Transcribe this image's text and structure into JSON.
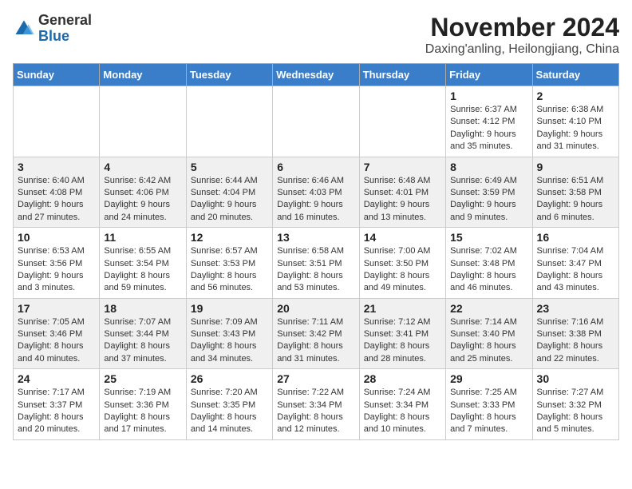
{
  "header": {
    "logo_general": "General",
    "logo_blue": "Blue",
    "month_year": "November 2024",
    "location": "Daxing'anling, Heilongjiang, China"
  },
  "days_of_week": [
    "Sunday",
    "Monday",
    "Tuesday",
    "Wednesday",
    "Thursday",
    "Friday",
    "Saturday"
  ],
  "weeks": [
    [
      {
        "day": "",
        "info": ""
      },
      {
        "day": "",
        "info": ""
      },
      {
        "day": "",
        "info": ""
      },
      {
        "day": "",
        "info": ""
      },
      {
        "day": "",
        "info": ""
      },
      {
        "day": "1",
        "info": "Sunrise: 6:37 AM\nSunset: 4:12 PM\nDaylight: 9 hours\nand 35 minutes."
      },
      {
        "day": "2",
        "info": "Sunrise: 6:38 AM\nSunset: 4:10 PM\nDaylight: 9 hours\nand 31 minutes."
      }
    ],
    [
      {
        "day": "3",
        "info": "Sunrise: 6:40 AM\nSunset: 4:08 PM\nDaylight: 9 hours\nand 27 minutes."
      },
      {
        "day": "4",
        "info": "Sunrise: 6:42 AM\nSunset: 4:06 PM\nDaylight: 9 hours\nand 24 minutes."
      },
      {
        "day": "5",
        "info": "Sunrise: 6:44 AM\nSunset: 4:04 PM\nDaylight: 9 hours\nand 20 minutes."
      },
      {
        "day": "6",
        "info": "Sunrise: 6:46 AM\nSunset: 4:03 PM\nDaylight: 9 hours\nand 16 minutes."
      },
      {
        "day": "7",
        "info": "Sunrise: 6:48 AM\nSunset: 4:01 PM\nDaylight: 9 hours\nand 13 minutes."
      },
      {
        "day": "8",
        "info": "Sunrise: 6:49 AM\nSunset: 3:59 PM\nDaylight: 9 hours\nand 9 minutes."
      },
      {
        "day": "9",
        "info": "Sunrise: 6:51 AM\nSunset: 3:58 PM\nDaylight: 9 hours\nand 6 minutes."
      }
    ],
    [
      {
        "day": "10",
        "info": "Sunrise: 6:53 AM\nSunset: 3:56 PM\nDaylight: 9 hours\nand 3 minutes."
      },
      {
        "day": "11",
        "info": "Sunrise: 6:55 AM\nSunset: 3:54 PM\nDaylight: 8 hours\nand 59 minutes."
      },
      {
        "day": "12",
        "info": "Sunrise: 6:57 AM\nSunset: 3:53 PM\nDaylight: 8 hours\nand 56 minutes."
      },
      {
        "day": "13",
        "info": "Sunrise: 6:58 AM\nSunset: 3:51 PM\nDaylight: 8 hours\nand 53 minutes."
      },
      {
        "day": "14",
        "info": "Sunrise: 7:00 AM\nSunset: 3:50 PM\nDaylight: 8 hours\nand 49 minutes."
      },
      {
        "day": "15",
        "info": "Sunrise: 7:02 AM\nSunset: 3:48 PM\nDaylight: 8 hours\nand 46 minutes."
      },
      {
        "day": "16",
        "info": "Sunrise: 7:04 AM\nSunset: 3:47 PM\nDaylight: 8 hours\nand 43 minutes."
      }
    ],
    [
      {
        "day": "17",
        "info": "Sunrise: 7:05 AM\nSunset: 3:46 PM\nDaylight: 8 hours\nand 40 minutes."
      },
      {
        "day": "18",
        "info": "Sunrise: 7:07 AM\nSunset: 3:44 PM\nDaylight: 8 hours\nand 37 minutes."
      },
      {
        "day": "19",
        "info": "Sunrise: 7:09 AM\nSunset: 3:43 PM\nDaylight: 8 hours\nand 34 minutes."
      },
      {
        "day": "20",
        "info": "Sunrise: 7:11 AM\nSunset: 3:42 PM\nDaylight: 8 hours\nand 31 minutes."
      },
      {
        "day": "21",
        "info": "Sunrise: 7:12 AM\nSunset: 3:41 PM\nDaylight: 8 hours\nand 28 minutes."
      },
      {
        "day": "22",
        "info": "Sunrise: 7:14 AM\nSunset: 3:40 PM\nDaylight: 8 hours\nand 25 minutes."
      },
      {
        "day": "23",
        "info": "Sunrise: 7:16 AM\nSunset: 3:38 PM\nDaylight: 8 hours\nand 22 minutes."
      }
    ],
    [
      {
        "day": "24",
        "info": "Sunrise: 7:17 AM\nSunset: 3:37 PM\nDaylight: 8 hours\nand 20 minutes."
      },
      {
        "day": "25",
        "info": "Sunrise: 7:19 AM\nSunset: 3:36 PM\nDaylight: 8 hours\nand 17 minutes."
      },
      {
        "day": "26",
        "info": "Sunrise: 7:20 AM\nSunset: 3:35 PM\nDaylight: 8 hours\nand 14 minutes."
      },
      {
        "day": "27",
        "info": "Sunrise: 7:22 AM\nSunset: 3:34 PM\nDaylight: 8 hours\nand 12 minutes."
      },
      {
        "day": "28",
        "info": "Sunrise: 7:24 AM\nSunset: 3:34 PM\nDaylight: 8 hours\nand 10 minutes."
      },
      {
        "day": "29",
        "info": "Sunrise: 7:25 AM\nSunset: 3:33 PM\nDaylight: 8 hours\nand 7 minutes."
      },
      {
        "day": "30",
        "info": "Sunrise: 7:27 AM\nSunset: 3:32 PM\nDaylight: 8 hours\nand 5 minutes."
      }
    ]
  ]
}
